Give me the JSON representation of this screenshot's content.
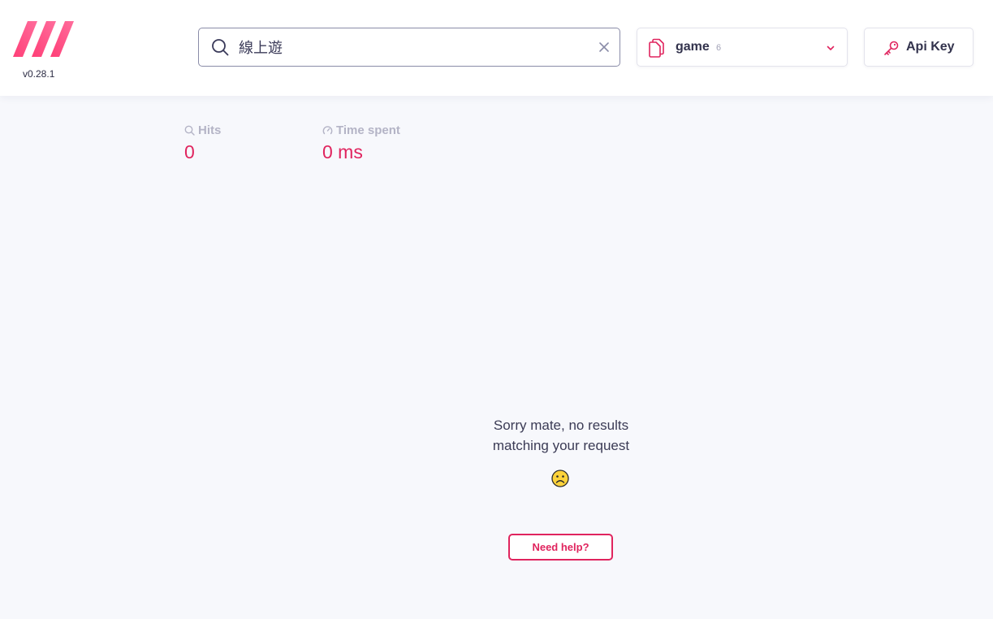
{
  "app": {
    "version": "v0.28.1",
    "brand_color": "#ff4f8b",
    "accent_color": "#e0245e"
  },
  "search": {
    "value": "線上遊",
    "icon": "search-icon",
    "clear_icon": "close-icon"
  },
  "index_selector": {
    "icon": "documents-icon",
    "name": "game",
    "count": "6",
    "chevron_icon": "chevron-down-icon"
  },
  "api_key": {
    "icon": "key-icon",
    "label": "Api Key"
  },
  "stats": {
    "hits": {
      "label": "Hits",
      "value": "0",
      "icon": "search-icon"
    },
    "time": {
      "label": "Time spent",
      "value": "0 ms",
      "icon": "speedometer-icon"
    }
  },
  "empty_state": {
    "line1": "Sorry mate, no results",
    "line2": "matching your request",
    "emoji_icon": "frown-face-icon",
    "help_label": "Need help?"
  }
}
